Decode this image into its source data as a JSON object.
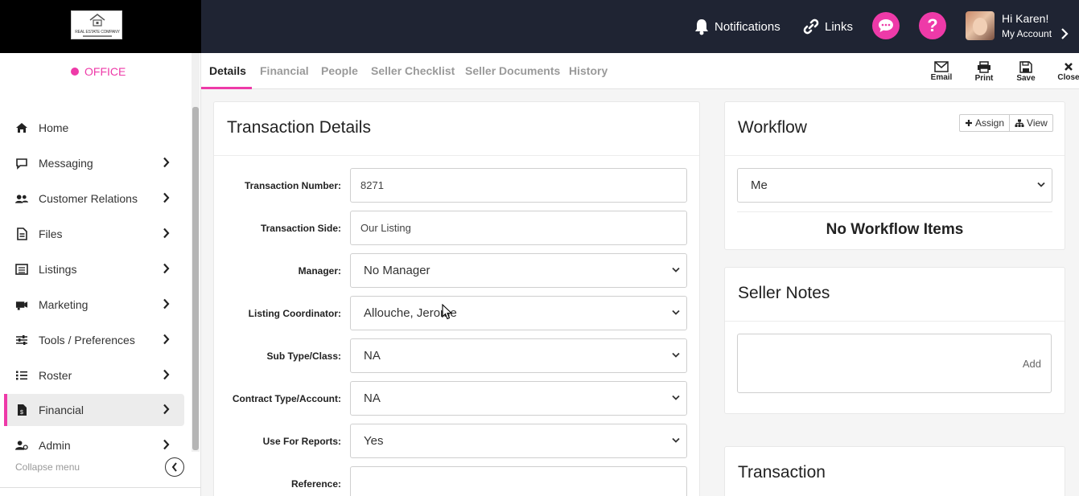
{
  "brand": {
    "logo_text": "REAL ESTATE COMPANY",
    "office_label": "OFFICE"
  },
  "topbar": {
    "notifications_label": "Notifications",
    "links_label": "Links",
    "greeting": "Hi Karen!",
    "account_label": "My Account"
  },
  "sidebar": {
    "items": [
      {
        "label": "Home",
        "icon": "home-icon"
      },
      {
        "label": "Messaging",
        "icon": "message-icon"
      },
      {
        "label": "Customer Relations",
        "icon": "users-icon"
      },
      {
        "label": "Files",
        "icon": "file-icon"
      },
      {
        "label": "Listings",
        "icon": "list-icon"
      },
      {
        "label": "Marketing",
        "icon": "marketing-icon"
      },
      {
        "label": "Tools / Preferences",
        "icon": "sliders-icon"
      },
      {
        "label": "Roster",
        "icon": "roster-icon"
      },
      {
        "label": "Financial",
        "icon": "financial-file-icon"
      },
      {
        "label": "Admin",
        "icon": "admin-icon"
      }
    ],
    "active_item": "Financial",
    "collapse_label": "Collapse menu"
  },
  "tabs": {
    "items": [
      "Details",
      "Financial",
      "People",
      "Seller Checklist",
      "Seller Documents",
      "History"
    ],
    "active": "Details"
  },
  "toolbar": {
    "email": "Email",
    "print": "Print",
    "save": "Save",
    "close": "Close"
  },
  "transaction_details": {
    "title": "Transaction Details",
    "fields": [
      {
        "label": "Transaction Number:",
        "value": "8271"
      },
      {
        "label": "Transaction Side:",
        "value": "Our Listing"
      },
      {
        "label": "Manager:",
        "value": "No Manager"
      },
      {
        "label": "Listing Coordinator:",
        "value": "Allouche, Jerome"
      },
      {
        "label": "Sub Type/Class:",
        "value": "NA"
      },
      {
        "label": "Contract Type/Account:",
        "value": "NA"
      },
      {
        "label": "Use For Reports:",
        "value": "Yes"
      },
      {
        "label": "Reference:",
        "value": ""
      }
    ]
  },
  "workflow": {
    "title": "Workflow",
    "assign_label": "Assign",
    "view_label": "View",
    "filter_value": "Me",
    "empty_text": "No Workflow Items"
  },
  "seller_notes": {
    "title": "Seller Notes",
    "add_label": "Add"
  },
  "transaction_panel": {
    "title": "Transaction"
  },
  "colors": {
    "accent": "#ee3aa8",
    "topbar": "#1f2433"
  }
}
